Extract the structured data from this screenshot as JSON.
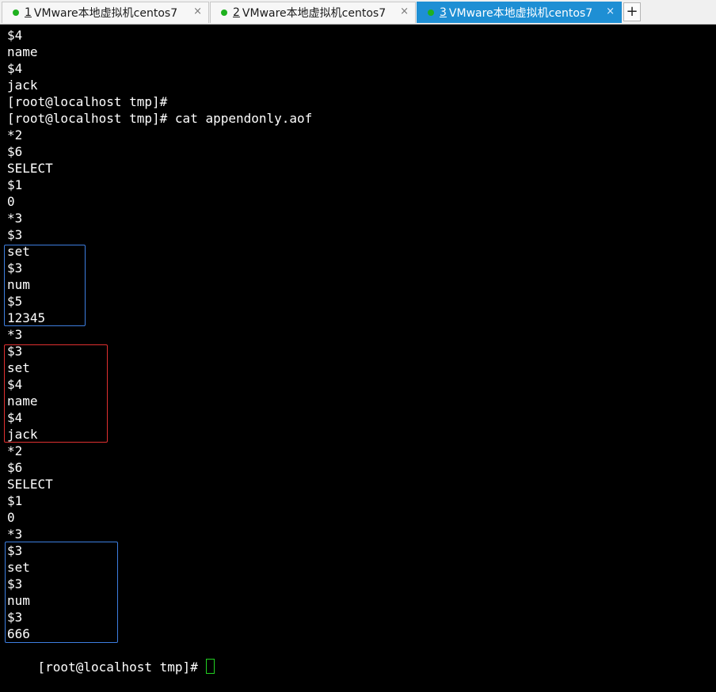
{
  "tabs": [
    {
      "number": "1",
      "title": "VMware本地虚拟机centos7",
      "close": "×",
      "active": false
    },
    {
      "number": "2",
      "title": "VMware本地虚拟机centos7",
      "close": "×",
      "active": false
    },
    {
      "number": "3",
      "title": "VMware本地虚拟机centos7",
      "close": "×",
      "active": true
    }
  ],
  "new_tab_label": "+",
  "colors": {
    "active_tab": "#1e8fd4",
    "status_dot": "#1fb11f",
    "terminal_bg": "#000000",
    "terminal_text": "#ffffff",
    "highlight_blue": "#3d7ee0",
    "highlight_red": "#e03030",
    "cursor": "#22d022"
  },
  "terminal": {
    "lines": [
      "$4",
      "name",
      "$4",
      "jack",
      "[root@localhost tmp]#",
      "[root@localhost tmp]# cat appendonly.aof",
      "*2",
      "$6",
      "SELECT",
      "$1",
      "0",
      "*3",
      "$3",
      "set",
      "$3",
      "num",
      "$5",
      "12345",
      "*3",
      "$3",
      "set",
      "$4",
      "name",
      "$4",
      "jack",
      "*2",
      "$6",
      "SELECT",
      "$1",
      "0",
      "*3",
      "$3",
      "set",
      "$3",
      "num",
      "$3",
      "666"
    ],
    "prompt": "[root@localhost tmp]# "
  }
}
